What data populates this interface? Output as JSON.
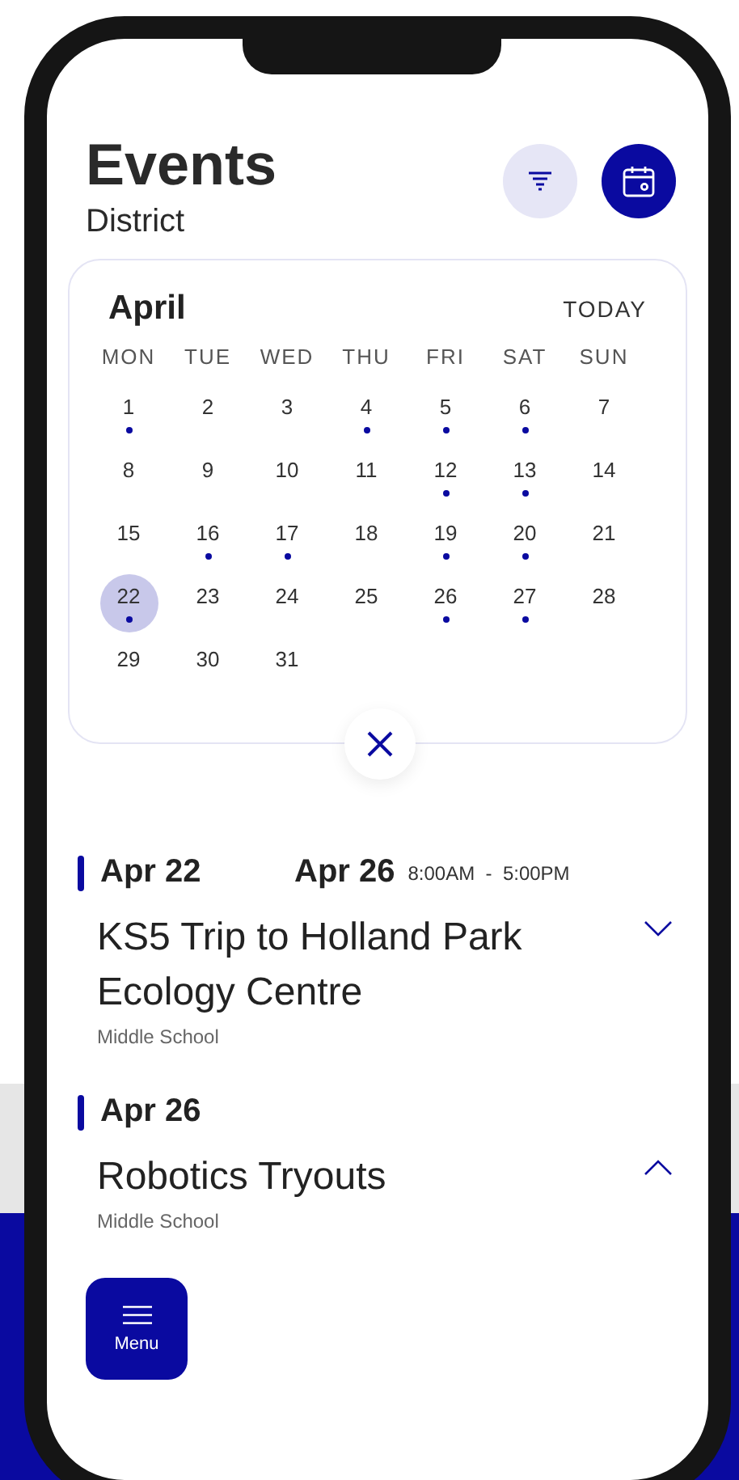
{
  "header": {
    "title": "Events",
    "subtitle": "District"
  },
  "calendar": {
    "month": "April",
    "today_label": "TODAY",
    "weekdays": [
      "MON",
      "TUE",
      "WED",
      "THU",
      "FRI",
      "SAT",
      "SUN"
    ],
    "days": [
      {
        "label": "1",
        "event": true,
        "selected": false
      },
      {
        "label": "2",
        "event": false,
        "selected": false
      },
      {
        "label": "3",
        "event": false,
        "selected": false
      },
      {
        "label": "4",
        "event": true,
        "selected": false
      },
      {
        "label": "5",
        "event": true,
        "selected": false
      },
      {
        "label": "6",
        "event": true,
        "selected": false
      },
      {
        "label": "7",
        "event": false,
        "selected": false
      },
      {
        "label": "8",
        "event": false,
        "selected": false
      },
      {
        "label": "9",
        "event": false,
        "selected": false
      },
      {
        "label": "10",
        "event": false,
        "selected": false
      },
      {
        "label": "11",
        "event": false,
        "selected": false
      },
      {
        "label": "12",
        "event": true,
        "selected": false
      },
      {
        "label": "13",
        "event": true,
        "selected": false
      },
      {
        "label": "14",
        "event": false,
        "selected": false
      },
      {
        "label": "15",
        "event": false,
        "selected": false
      },
      {
        "label": "16",
        "event": true,
        "selected": false
      },
      {
        "label": "17",
        "event": true,
        "selected": false
      },
      {
        "label": "18",
        "event": false,
        "selected": false
      },
      {
        "label": "19",
        "event": true,
        "selected": false
      },
      {
        "label": "20",
        "event": true,
        "selected": false
      },
      {
        "label": "21",
        "event": false,
        "selected": false
      },
      {
        "label": "22",
        "event": true,
        "selected": true
      },
      {
        "label": "23",
        "event": false,
        "selected": false
      },
      {
        "label": "24",
        "event": false,
        "selected": false
      },
      {
        "label": "25",
        "event": false,
        "selected": false
      },
      {
        "label": "26",
        "event": true,
        "selected": false
      },
      {
        "label": "27",
        "event": true,
        "selected": false
      },
      {
        "label": "28",
        "event": false,
        "selected": false
      },
      {
        "label": "29",
        "event": false,
        "selected": false
      },
      {
        "label": "30",
        "event": false,
        "selected": false
      },
      {
        "label": "31",
        "event": false,
        "selected": false
      }
    ]
  },
  "events": [
    {
      "date": "Apr 22",
      "end_date": "Apr 26",
      "time": "8:00AM  -  5:00PM",
      "title": "KS5 Trip to Holland Park Ecology Centre",
      "group": "Middle School",
      "expanded": false
    },
    {
      "date": "Apr 26",
      "title": "Robotics Tryouts",
      "group": "Middle School",
      "expanded": true
    }
  ],
  "menu_button": {
    "label": "Menu"
  }
}
